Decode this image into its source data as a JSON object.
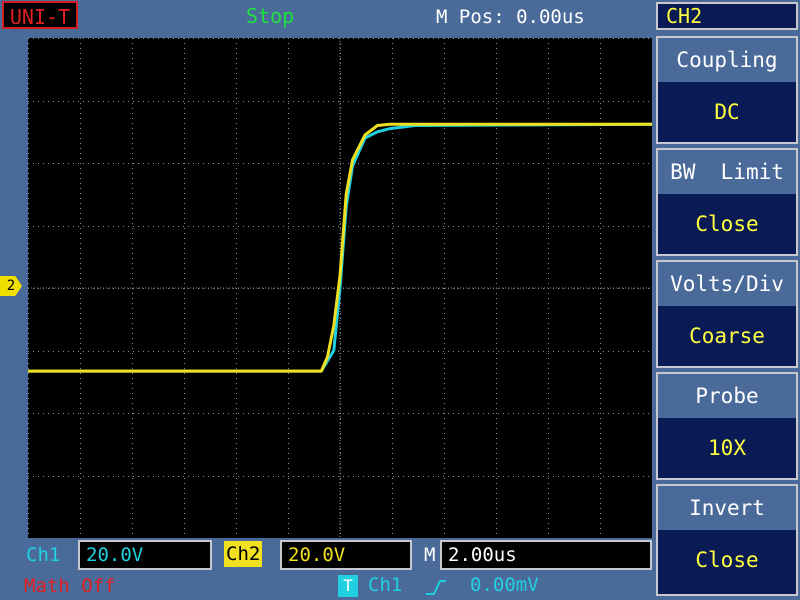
{
  "brand": "UNI-T",
  "status": {
    "run_state": "Stop",
    "m_pos": "M Pos: 0.00us"
  },
  "menu": {
    "channel": "CH2",
    "items": [
      {
        "label": "Coupling",
        "value": "DC"
      },
      {
        "label": "BW  Limit",
        "value": "Close"
      },
      {
        "label": "Volts/Div",
        "value": "Coarse"
      },
      {
        "label": "Probe",
        "value": "10X"
      },
      {
        "label": "Invert",
        "value": "Close"
      }
    ]
  },
  "bottom": {
    "ch1_label": "Ch1",
    "ch1_scale": "20.0V",
    "ch2_label": "Ch2",
    "ch2_scale": "20.0V",
    "m_label": "M",
    "time_scale": "2.00us",
    "math": "Math Off",
    "trigger_icon": "T",
    "trigger_source": "Ch1",
    "trigger_slope": "rising-edge-icon",
    "trigger_level": "0.00mV"
  },
  "channel_marker": "2",
  "colors": {
    "ch1": "#20d0e0",
    "ch2": "#f0e020",
    "grid": "#8a8a8a",
    "accent": "#d02020"
  },
  "chart_data": {
    "type": "line",
    "title": "",
    "xlabel": "",
    "ylabel": "",
    "xlim": [
      -10,
      10
    ],
    "ylim": [
      -4,
      4
    ],
    "grid": true,
    "series": [
      {
        "name": "Ch1",
        "color": "#20d0e0",
        "x": [
          -10,
          -0.6,
          -0.2,
          0.0,
          0.2,
          0.4,
          0.8,
          1.2,
          1.6,
          2.4,
          10
        ],
        "y": [
          -1.33,
          -1.33,
          -1.0,
          0.0,
          1.3,
          1.95,
          2.4,
          2.5,
          2.55,
          2.6,
          2.62
        ]
      },
      {
        "name": "Ch2",
        "color": "#f0e020",
        "x": [
          -10,
          -0.6,
          -0.4,
          -0.2,
          0.0,
          0.2,
          0.4,
          0.8,
          1.2,
          1.6,
          2.4,
          10
        ],
        "y": [
          -1.33,
          -1.33,
          -1.1,
          -0.6,
          0.2,
          1.5,
          2.05,
          2.45,
          2.6,
          2.62,
          2.62,
          2.62
        ]
      }
    ]
  }
}
